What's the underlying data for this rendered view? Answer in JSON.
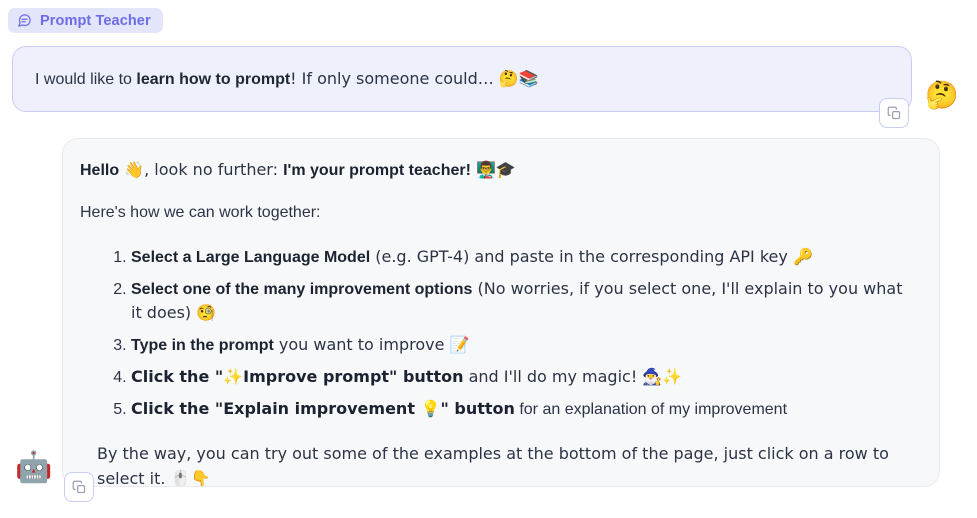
{
  "header": {
    "badge_label": "Prompt Teacher",
    "badge_icon": "chat-bubble-icon",
    "badge_bg": "#e3e5fb",
    "badge_fg": "#6c6ce8"
  },
  "user_message": {
    "text_plain": "I would like to ",
    "text_bold": "learn how to prompt",
    "text_tail": "! If only someone could… 🤔📚",
    "avatar_emoji": "🤔",
    "copy_icon": "copy-icon",
    "bubble_bg": "#eef0fc",
    "bubble_border": "#c9cdf4"
  },
  "assistant_message": {
    "avatar_emoji": "🤖",
    "copy_icon": "copy-icon",
    "bubble_bg": "#f7f8fa",
    "bubble_border": "#e8eaee",
    "greeting_bold_1": "Hello",
    "greeting_mid": " 👋, look no further: ",
    "greeting_bold_2": "I'm your prompt teacher!",
    "greeting_tail": " 👨‍🏫🎓",
    "intro": "Here's how we can work together:",
    "steps": [
      {
        "bold": "Select a Large Language Model",
        "rest": " (e.g. GPT-4) and paste in the corresponding API key 🔑"
      },
      {
        "bold": "Select one of the many improvement options",
        "rest": " (No worries, if you select one, I'll explain to you what it does) 🧐"
      },
      {
        "bold": "Type in the prompt",
        "rest": " you want to improve 📝"
      },
      {
        "bold": "Click the \"✨Improve prompt\" button",
        "rest": " and I'll do my magic! 🧙‍♂️✨"
      },
      {
        "bold": "Click the \"Explain improvement 💡\" button",
        "rest": " for an explanation of my improvement"
      }
    ],
    "outro": "By the way, you can try out some of the examples at the bottom of the page, just click on a row to select it. 🖱️👇"
  }
}
